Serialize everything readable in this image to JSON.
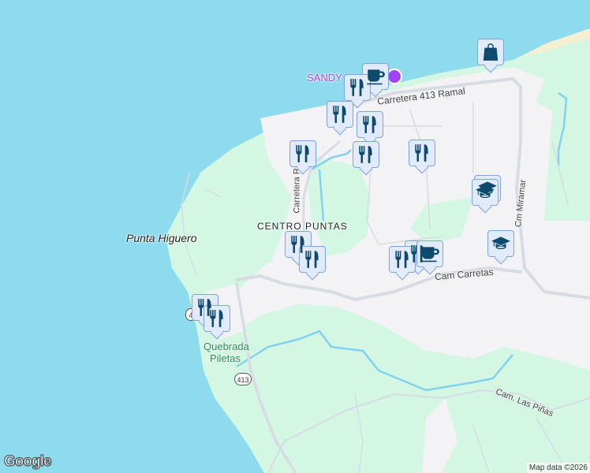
{
  "map": {
    "colors": {
      "water": "#8edbed",
      "land": "#d3f7e3",
      "urban": "#f3f2f4",
      "road": "#d7dce4",
      "stream": "#80d2f0",
      "marker_bg": "#e2ebfc",
      "marker_border": "#7ea3e3",
      "marker_icon": "#0d4a6b",
      "poi_purple": "#a142f4"
    },
    "labels": {
      "sandy": "SANDY",
      "carretera_413_ramal": "Carretera 413 Ramal",
      "carretera_ramal": "Carretera Ramal",
      "centro_puntas": "CENTRO PUNTAS",
      "punta_higuero": "Punta Higuero",
      "cam_carretas": "Cam Carretas",
      "cm_miramar": "Cm Miramar",
      "quebrada_piletas_1": "Quebrada",
      "quebrada_piletas_2": "Piletas",
      "cam_las_pinas": "Cam. Las Piñas"
    },
    "route_shields": [
      "413",
      "4"
    ],
    "markers": [
      {
        "type": "shopping-bag"
      },
      {
        "type": "coffee"
      },
      {
        "type": "restaurant"
      },
      {
        "type": "restaurant"
      },
      {
        "type": "restaurant"
      },
      {
        "type": "restaurant"
      },
      {
        "type": "restaurant"
      },
      {
        "type": "restaurant"
      },
      {
        "type": "school"
      },
      {
        "type": "school"
      },
      {
        "type": "school"
      },
      {
        "type": "restaurant"
      },
      {
        "type": "restaurant"
      },
      {
        "type": "restaurant"
      },
      {
        "type": "coffee"
      },
      {
        "type": "restaurant"
      },
      {
        "type": "restaurant"
      },
      {
        "type": "restaurant"
      }
    ]
  },
  "footer": {
    "logo": "Google",
    "attribution": "Map data ©2026"
  }
}
